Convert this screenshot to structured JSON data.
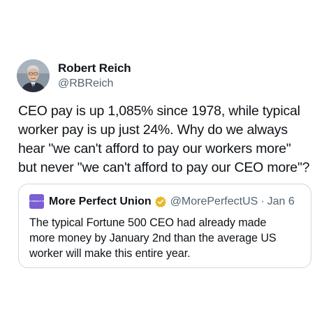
{
  "tweet": {
    "author": {
      "display_name": "Robert Reich",
      "handle": "@RBReich",
      "avatar_icon": "person-avatar"
    },
    "text": "CEO pay is up 1,085% since 1978, while typical\nworker pay is up just 24%. Why do we always\nhear \"we can't afford to pay our workers more\"\nbut never \"we can't afford to pay our CEO more\"?"
  },
  "quoted_tweet": {
    "logo_text": "MORE PERFECT UNION",
    "logo_color": "#7b5fd3",
    "display_name": "More Perfect Union",
    "verified_icon": "gold-verified-badge-icon",
    "verified_color": "#e8b829",
    "handle": "@MorePerfectUS",
    "separator": "·",
    "date": "Jan 6",
    "text": "The typical Fortune 500 CEO had already made\nmore money by January 2nd than the average US\nworker will make this entire year."
  }
}
